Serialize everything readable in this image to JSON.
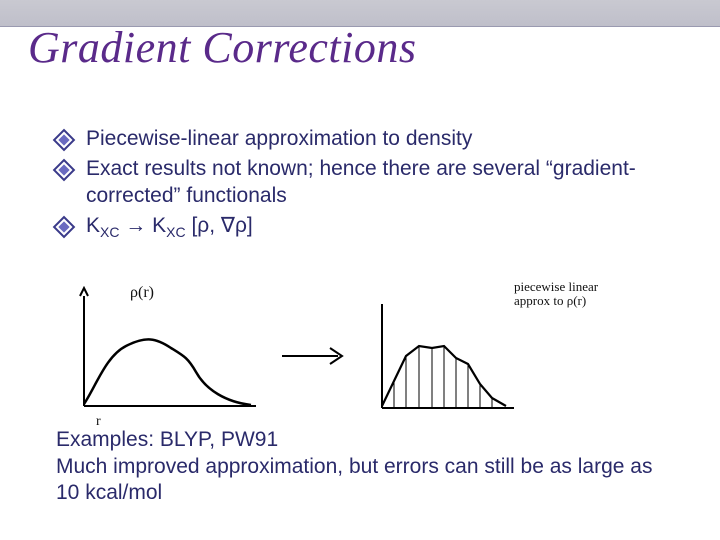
{
  "title": "Gradient Corrections",
  "bullets": {
    "b1": "Piecewise-linear approximation to density",
    "b2": "Exact results not known; hence there are several “gradient-corrected” functionals",
    "b3_pre": "K",
    "b3_sub1": "XC",
    "b3_mid": " → K",
    "b3_sub2": "XC",
    "b3_post": " [ρ, ∇ρ]"
  },
  "fig": {
    "left_label": "ρ(r)",
    "left_xlabel": "r",
    "right_label": "piecewise linear\napprox to ρ(r)"
  },
  "footer": {
    "line1": "Examples: BLYP, PW91",
    "line2": "Much improved approximation, but errors can still be as large as 10 kcal/mol"
  }
}
